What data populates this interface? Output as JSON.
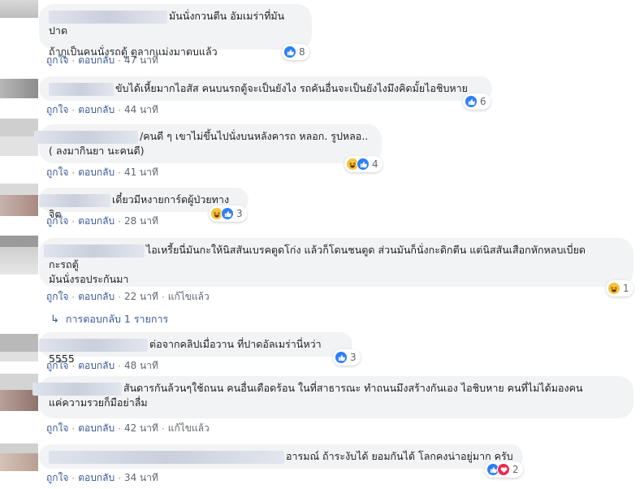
{
  "colors": {
    "bubble": "#f2f3f5",
    "link": "#385898",
    "meta": "#606770",
    "like": "#2d7ff9",
    "haha": "#f7c43c",
    "love": "#f0284a"
  },
  "icons": {
    "like": "thumbs-up-icon",
    "haha": "laugh-emoji-icon",
    "love": "heart-icon",
    "reply_arrow": "reply-arrow-icon"
  },
  "comments": [
    {
      "lines": [
        "มันนั่งกวนตีน อัมเมร่าที่มันปาด",
        "ถ้ากูเป็นคนนั่งรถตู้ ตูลากแม่งมาตบแล้ว"
      ],
      "like": "ถูกใจ",
      "reply": "ตอบกลับ",
      "time": "47 นาที",
      "reactions": [
        "like"
      ],
      "count": "8"
    },
    {
      "lines": [
        "ขับได้เหี้ยมากไอสัส คนบนรถตู้จะเป็นยังไง รถคันอื่นจะเป็นยังไงมึงคิดมั้ยไอชิบหาย"
      ],
      "like": "ถูกใจ",
      "reply": "ตอบกลับ",
      "time": "44 นาที",
      "reactions": [
        "like"
      ],
      "count": "6"
    },
    {
      "lines": [
        "/คนดี ๆ เขาไม่ขึ้นไปนั่งบนหลังคารถ หลอก. รูปหลอ..",
        "( ลงมากินยา นะคนดี)"
      ],
      "like": "ถูกใจ",
      "reply": "ตอบกลับ",
      "time": "41 นาที",
      "reactions": [
        "haha",
        "like"
      ],
      "count": "4"
    },
    {
      "lines": [
        "เดี๋ยวมีหงายการ์ดผู้ป่วยทางจิต"
      ],
      "like": "ถูกใจ",
      "reply": "ตอบกลับ",
      "time": "28 นาที",
      "reactions": [
        "haha",
        "like"
      ],
      "count": "3"
    },
    {
      "lines": [
        "ไอเหรี้ยนี่มันกะให้นิสสันเบรคตูดโก่ง แล้วก็โดนชนตูด ส่วนมันก็นั่งกะดิกตีน แต่นิสสันเสือกหักหลบเบี่ยด",
        "กะรถตู้",
        "มันนั่งรอประกันมา"
      ],
      "like": "ถูกใจ",
      "reply": "ตอบกลับ",
      "time": "22 นาที",
      "edited": "แก้ไขแล้ว",
      "reactions": [
        "haha"
      ],
      "count": "1"
    },
    {
      "lines": [
        "ต่อจากคลิปเมื่อวาน ที่ปาดอัลเมร่านี่หว่า 5555"
      ],
      "like": "ถูกใจ",
      "reply": "ตอบกลับ",
      "time": "48 นาที",
      "reactions": [
        "like"
      ],
      "count": "3"
    },
    {
      "lines": [
        "สันดารกันล้วนๆใช้ถนน คนอื่นเดือดร้อน ในที่สาธารณะ ทำถนนมึงสร้างกันเอง ไอชิบหาย คนที่ไม่ได้มองคน",
        "แค่ความรวยก็มือย่าลื่ม"
      ],
      "like": "ถูกใจ",
      "reply": "ตอบกลับ",
      "time": "42 นาที",
      "edited": "แก้ไขแล้ว",
      "reactions": [],
      "count": ""
    },
    {
      "lines": [
        "อารมณ์ ถ้าระงับได้ ยอมกันได้ โลกคงน่าอยู่มาก ครับ"
      ],
      "like": "ถูกใจ",
      "reply": "ตอบกลับ",
      "time": "34 นาที",
      "reactions": [
        "like",
        "love"
      ],
      "count": "2"
    }
  ],
  "replies_link": "การตอบกลับ 1 รายการ"
}
